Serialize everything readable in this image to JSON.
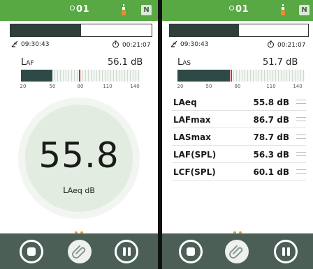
{
  "colors": {
    "accent": "#58a844",
    "bar": "#4b5f57",
    "peak": "#d62c2c",
    "dots": "#e89b3a"
  },
  "left": {
    "status": {
      "device_num": "01",
      "badge": "N"
    },
    "progress_fraction": 0.5,
    "clock": "09:30:43",
    "elapsed": "00:21:07",
    "level_name": {
      "main": "L",
      "sub": "AF"
    },
    "level_value": "56.1  dB",
    "meter": {
      "fill_fraction": 0.265,
      "peak_fraction": 0.49,
      "scale": [
        "20",
        "50",
        "80",
        "110",
        "140"
      ]
    },
    "big_value": "55.8",
    "big_unit": {
      "main": "L",
      "sub": "Aeq dB"
    }
  },
  "right": {
    "status": {
      "device_num": "01",
      "badge": "N"
    },
    "progress_fraction": 0.5,
    "clock": "09:30:43",
    "elapsed": "00:21:07",
    "level_name": {
      "main": "L",
      "sub": "AS"
    },
    "level_value": "51.7  dB",
    "meter": {
      "fill_fraction": 0.41,
      "peak_fraction": 0.42,
      "scale": [
        "20",
        "50",
        "80",
        "110",
        "140"
      ]
    },
    "measurements": [
      {
        "name": "LAeq",
        "value": "55.8 dB"
      },
      {
        "name": "LAFmax",
        "value": "86.7 dB"
      },
      {
        "name": "LASmax",
        "value": "78.7 dB"
      },
      {
        "name": "LAF(SPL)",
        "value": "56.3 dB"
      },
      {
        "name": "LCF(SPL)",
        "value": "60.1 dB"
      }
    ]
  },
  "icons": {
    "stop": "stop-icon",
    "clip": "paperclip-icon",
    "pause": "pause-icon",
    "probe": "microphone-probe-icon",
    "clock": "clock-start-icon",
    "timer": "stopwatch-icon"
  }
}
